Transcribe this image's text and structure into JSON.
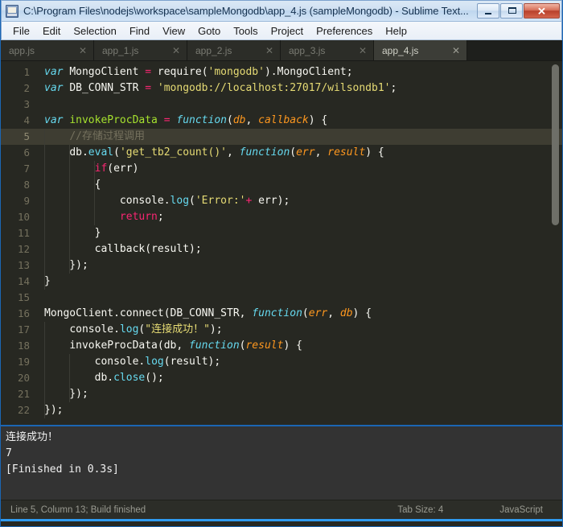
{
  "window": {
    "title": "C:\\Program Files\\nodejs\\workspace\\sampleMongodb\\app_4.js (sampleMongodb) - Sublime Text...",
    "icon": "sublime-text-icon",
    "controls": {
      "minimize": "minimize-icon",
      "maximize": "maximize-icon",
      "close": "✕"
    }
  },
  "menubar": {
    "items": [
      {
        "label": "File"
      },
      {
        "label": "Edit"
      },
      {
        "label": "Selection"
      },
      {
        "label": "Find"
      },
      {
        "label": "View"
      },
      {
        "label": "Goto"
      },
      {
        "label": "Tools"
      },
      {
        "label": "Project"
      },
      {
        "label": "Preferences"
      },
      {
        "label": "Help"
      }
    ]
  },
  "tabs": [
    {
      "label": "app.js",
      "active": false,
      "close": "✕"
    },
    {
      "label": "app_1.js",
      "active": false,
      "close": "✕"
    },
    {
      "label": "app_2.js",
      "active": false,
      "close": "✕"
    },
    {
      "label": "app_3.js",
      "active": false,
      "close": "✕"
    },
    {
      "label": "app_4.js",
      "active": true,
      "close": "✕"
    }
  ],
  "editor": {
    "current_line": 5,
    "line_numbers": [
      "1",
      "2",
      "3",
      "4",
      "5",
      "6",
      "7",
      "8",
      "9",
      "10",
      "11",
      "12",
      "13",
      "14",
      "15",
      "16",
      "17",
      "18",
      "19",
      "20",
      "21",
      "22"
    ],
    "lines": [
      {
        "n": 1,
        "text": "var MongoClient = require('mongodb').MongoClient;"
      },
      {
        "n": 2,
        "text": "var DB_CONN_STR = 'mongodb://localhost:27017/wilsondb1';"
      },
      {
        "n": 3,
        "text": ""
      },
      {
        "n": 4,
        "text": "var invokeProcData = function(db, callback) {"
      },
      {
        "n": 5,
        "text": "    //存储过程调用"
      },
      {
        "n": 6,
        "text": "    db.eval('get_tb2_count()', function(err, result) {"
      },
      {
        "n": 7,
        "text": "        if(err)"
      },
      {
        "n": 8,
        "text": "        {"
      },
      {
        "n": 9,
        "text": "            console.log('Error:'+ err);"
      },
      {
        "n": 10,
        "text": "            return;"
      },
      {
        "n": 11,
        "text": "        }"
      },
      {
        "n": 12,
        "text": "        callback(result);"
      },
      {
        "n": 13,
        "text": "    });"
      },
      {
        "n": 14,
        "text": "}"
      },
      {
        "n": 15,
        "text": ""
      },
      {
        "n": 16,
        "text": "MongoClient.connect(DB_CONN_STR, function(err, db) {"
      },
      {
        "n": 17,
        "text": "    console.log(\"连接成功！\");"
      },
      {
        "n": 18,
        "text": "    invokeProcData(db, function(result) {"
      },
      {
        "n": 19,
        "text": "        console.log(result);"
      },
      {
        "n": 20,
        "text": "        db.close();"
      },
      {
        "n": 21,
        "text": "    });"
      },
      {
        "n": 22,
        "text": "});"
      }
    ],
    "colors": {
      "background": "#272822",
      "foreground": "#f8f8f2",
      "keyword": "#66d9ef",
      "operator": "#f92672",
      "function_name": "#a6e22e",
      "string": "#e6db74",
      "comment": "#75715e",
      "parameter": "#fd971f",
      "current_line_highlight": "#3e3d32",
      "line_number": "#75715e"
    }
  },
  "console_panel": {
    "lines": [
      "连接成功！",
      "7",
      "[Finished in 0.3s]"
    ]
  },
  "statusbar": {
    "left": "Line 5, Column 13; Build finished",
    "tab_size": "Tab Size: 4",
    "language": "JavaScript"
  }
}
